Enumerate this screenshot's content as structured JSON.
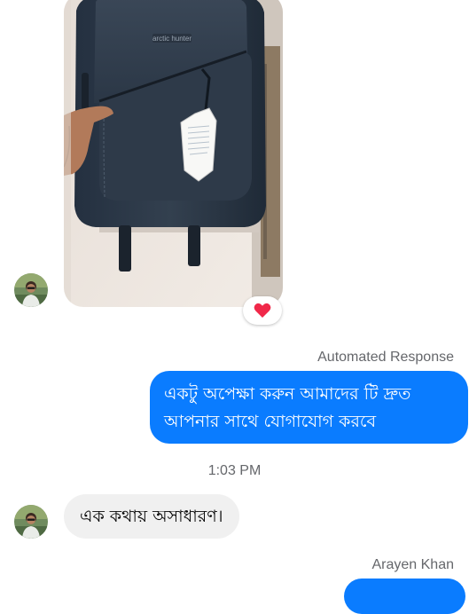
{
  "messages": {
    "automated_label": "Automated Response",
    "outgoing_text": "একটু অপেক্ষা করুন আমাদের টি দ্রুত আপনার সাথে যোগাযোগ করবে",
    "timestamp": "1:03 PM",
    "incoming_text": "এক কথায় অসাধারণ।",
    "sender_name": "Arayen Khan"
  },
  "image": {
    "bag_brand": "arctic hunter"
  },
  "reaction": {
    "icon": "heart-icon",
    "color": "#f02849"
  },
  "colors": {
    "outgoing_bubble": "#0a7cff",
    "incoming_bubble": "#f0f0f0",
    "meta_text": "#65676b"
  }
}
